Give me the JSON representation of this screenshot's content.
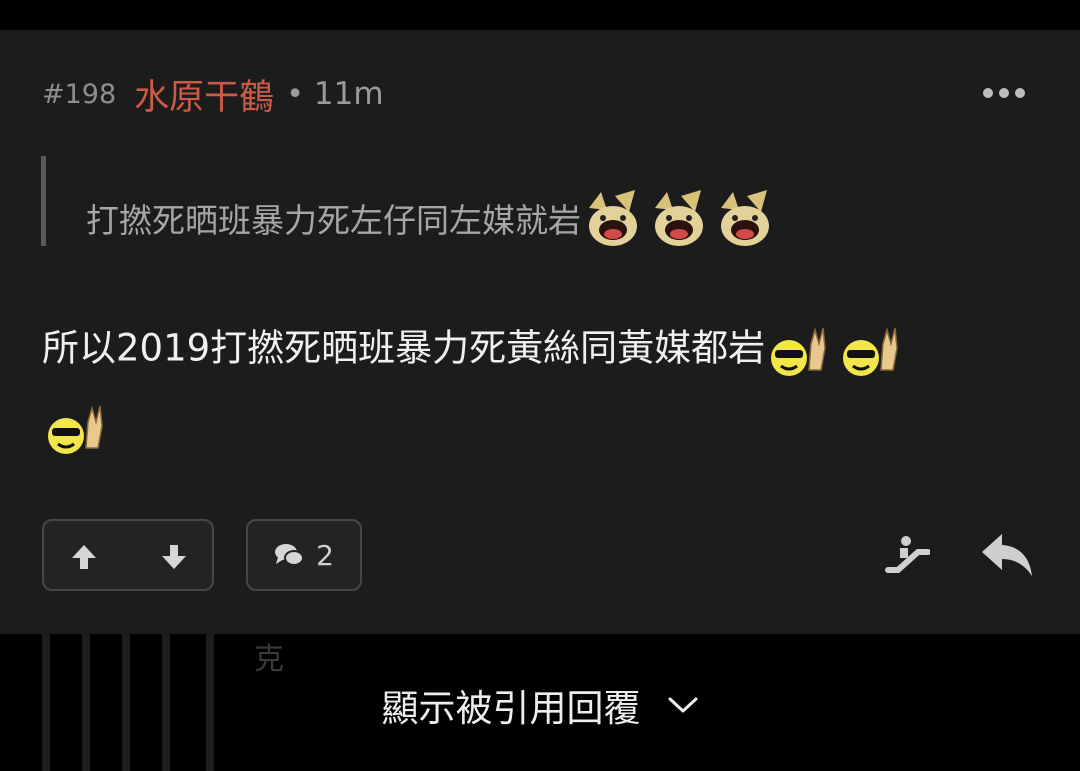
{
  "post": {
    "number": "#198",
    "author": "水原干鶴",
    "separator": "•",
    "time": "11m",
    "quote_text": "打撚死晒班暴力死左仔同左媒就岩",
    "body_text": "所以2019打撚死晒班暴力死黃絲同黃媒都岩",
    "reply_count": "2"
  },
  "footer": {
    "show_quoted_label": "顯示被引用回覆",
    "ghost_text": "克"
  },
  "icons": {
    "more": "more-dots-icon",
    "upvote": "arrow-up-icon",
    "downvote": "arrow-down-icon",
    "replies": "chat-bubbles-icon",
    "share": "escalator-icon",
    "reply": "reply-arrow-icon",
    "expand": "chevron-down-icon"
  },
  "colors": {
    "author": "#cc5a46",
    "card": "#1c1c1c",
    "background": "#000000"
  }
}
